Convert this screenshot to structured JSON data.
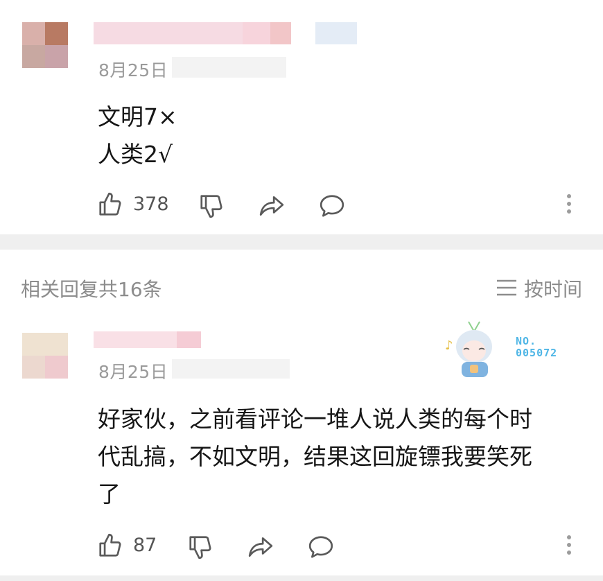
{
  "comments": [
    {
      "date": "8月25日",
      "lines": [
        "文明7×",
        "人类2√"
      ],
      "likes": "378"
    }
  ],
  "replies_header": "相关回复共16条",
  "sort_label": "按时间",
  "replies": [
    {
      "date": "8月25日",
      "lines": [
        "好家伙，之前看评论一堆人说人类的每个时",
        "代乱搞，不如文明，结果这回旋镖我要笑死",
        "了"
      ],
      "likes": "87",
      "badge": {
        "line1": "NO.",
        "line2": "005072"
      }
    }
  ],
  "colors": {
    "badge_text": "#4fb6e6",
    "separator": "#efefef",
    "icon_gray": "#5a5a5a"
  }
}
